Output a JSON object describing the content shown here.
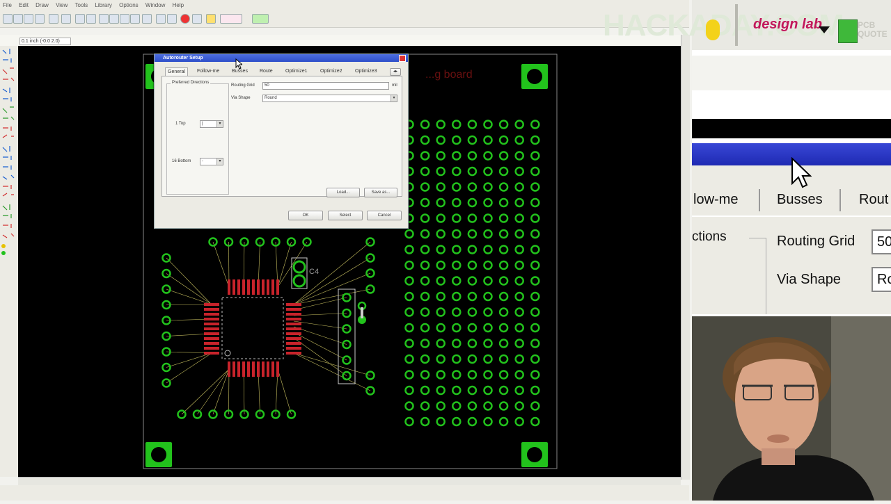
{
  "menu": [
    "File",
    "Edit",
    "Draw",
    "View",
    "Tools",
    "Library",
    "Options",
    "Window",
    "Help"
  ],
  "coord_readout": "0.1 inch (-0.0 2.0)",
  "board_text": "...g board",
  "component_label": "C4",
  "dialog": {
    "title": "Autorouter Setup",
    "tabs": [
      "General",
      "Follow-me",
      "Busses",
      "Route",
      "Optimize1",
      "Optimize2",
      "Optimize3"
    ],
    "group_label": "Preferred Directions",
    "top_label": "1 Top",
    "top_value": "|",
    "bottom_label": "16 Bottom",
    "bottom_value": "-",
    "routing_grid_label": "Routing Grid",
    "routing_grid_value": "50",
    "routing_grid_unit": "mil",
    "via_shape_label": "Via Shape",
    "via_shape_value": "Round",
    "load_label": "Load...",
    "save_as_label": "Save as...",
    "ok_label": "OK",
    "select_label": "Select",
    "cancel_label": "Cancel"
  },
  "zoom_panel": {
    "brand": "design lab",
    "watermark": "HACKADAY.COM",
    "pcb_text": "PCB QUOTE",
    "tab_follow": "low-me",
    "tab_busses": "Busses",
    "tab_route": "Rout",
    "group_partial": "ctions",
    "routing_grid_label": "Routing Grid",
    "routing_grid_value": "50",
    "via_shape_label": "Via Shape",
    "via_shape_value": "Ro"
  },
  "colors": {
    "pad": "#22c21c",
    "smd": "#c8232b",
    "airwire": "#c8c060",
    "board": "#000000",
    "titlebar": "#2e4fc9"
  }
}
